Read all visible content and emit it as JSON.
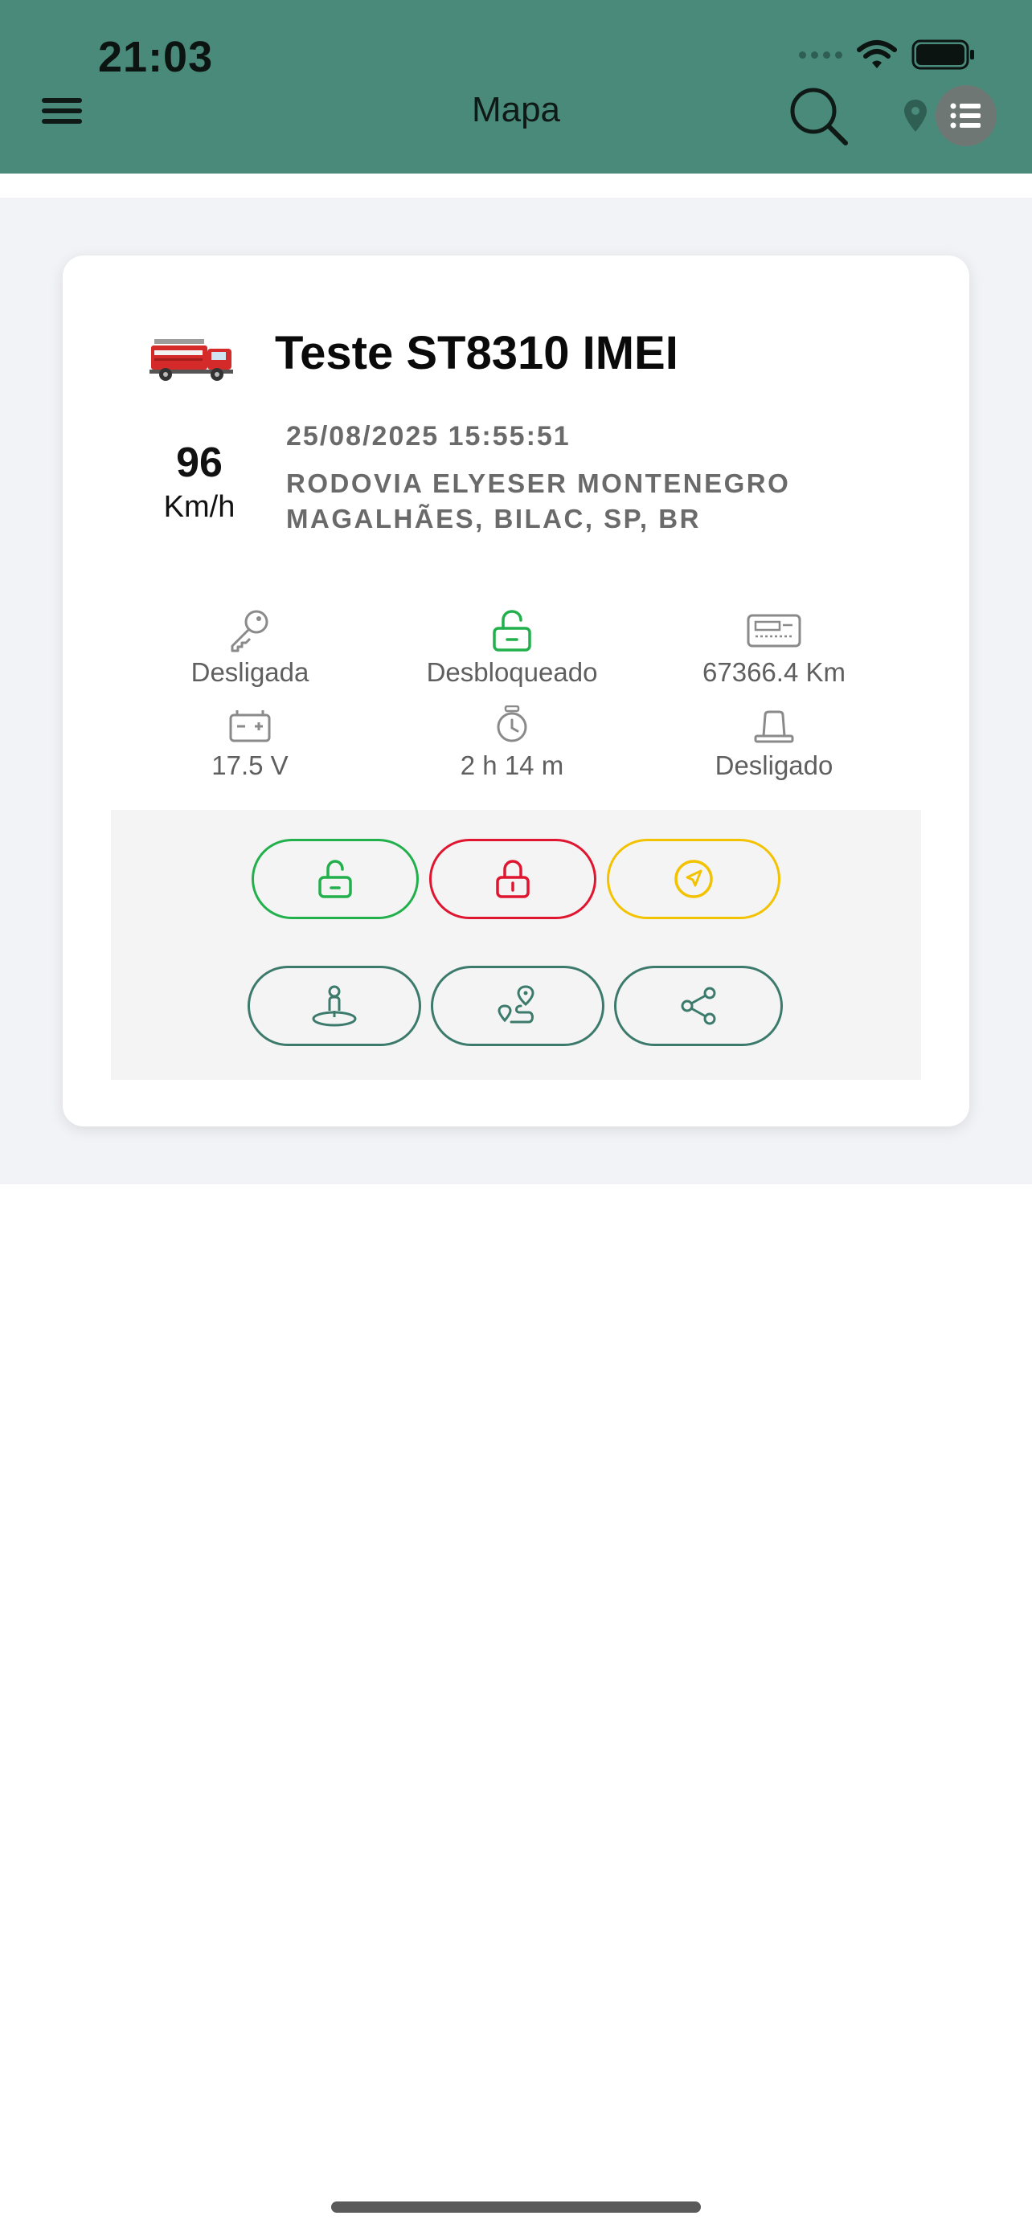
{
  "status_bar": {
    "time": "21:03"
  },
  "header": {
    "title": "Mapa"
  },
  "vehicle": {
    "name": "Teste ST8310 IMEI",
    "speed": "96",
    "speed_unit": "Km/h",
    "datetime": "25/08/2025 15:55:51",
    "address": "RODOVIA ELYESER MONTENEGRO MAGALHÃES, BILAC, SP, BR"
  },
  "info": [
    {
      "icon": "key-icon",
      "label": "Desligada"
    },
    {
      "icon": "unlock-icon",
      "label": "Desbloqueado"
    },
    {
      "icon": "odometer-icon",
      "label": "67366.4 Km"
    },
    {
      "icon": "battery-icon",
      "label": "17.5 V"
    },
    {
      "icon": "stopwatch-icon",
      "label": "2 h 14 m"
    },
    {
      "icon": "siren-icon",
      "label": "Desligado"
    }
  ],
  "actions": [
    {
      "icon": "unlock-icon",
      "color": "#21b04b"
    },
    {
      "icon": "lock-icon",
      "color": "#e0152f"
    },
    {
      "icon": "navigation-icon",
      "color": "#f3c200"
    },
    {
      "icon": "street-view-icon",
      "color": "#3c7a6b"
    },
    {
      "icon": "route-icon",
      "color": "#3c7a6b"
    },
    {
      "icon": "share-icon",
      "color": "#3c7a6b"
    }
  ],
  "colors": {
    "header": "#4a8a7a",
    "card_bg": "#ffffff",
    "page_bg": "#f2f3f7"
  }
}
